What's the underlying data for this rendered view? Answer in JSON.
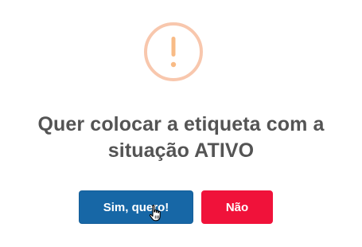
{
  "dialog": {
    "icon": "warning-exclamation-icon",
    "title": "Quer colocar a etiqueta com a situação ATIVO",
    "confirm_label": "Sim, quero!",
    "cancel_label": "Não",
    "colors": {
      "icon": "#f8bb86",
      "title": "#545454",
      "confirm": "#1767a6",
      "cancel": "#f0123a"
    }
  },
  "cursor": "hand-pointer-icon"
}
